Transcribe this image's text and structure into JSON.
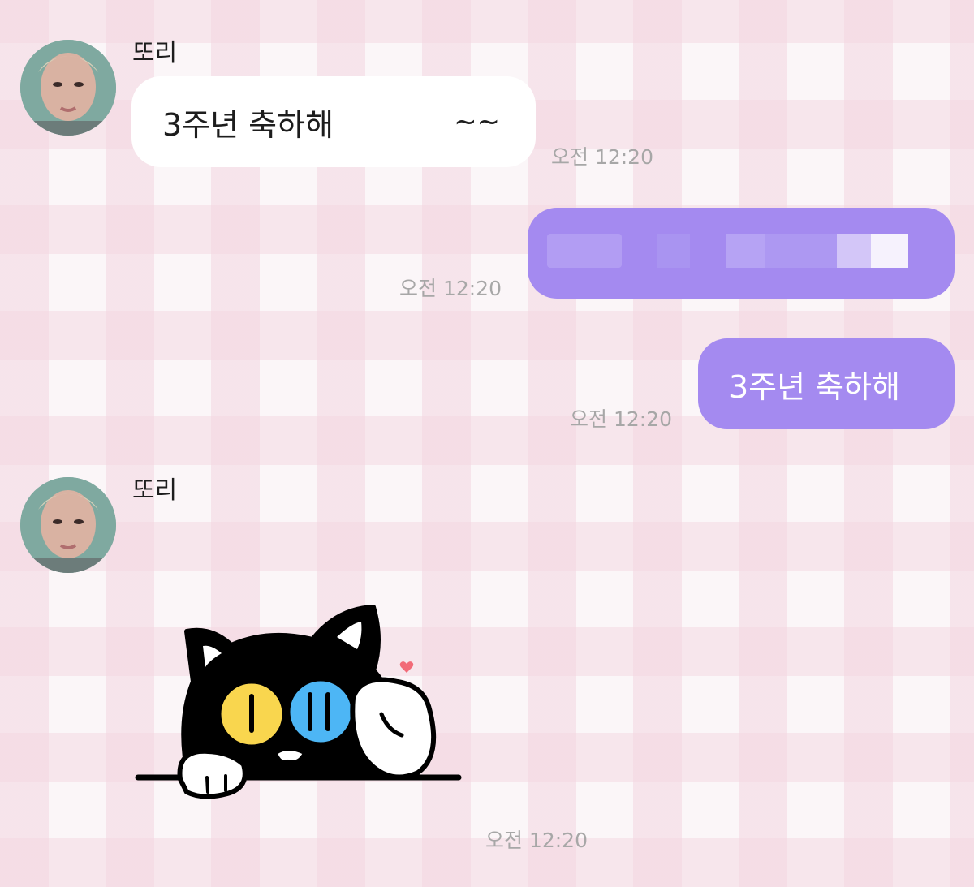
{
  "messages": [
    {
      "direction": "incoming",
      "sender": "또리",
      "text": "3주년 축하해",
      "suffix": "~~",
      "time": "오전 12:20"
    },
    {
      "direction": "outgoing",
      "text": "",
      "blurred": true,
      "time": "오전 12:20"
    },
    {
      "direction": "outgoing",
      "text": "3주년 축하해",
      "time": "오전 12:20"
    },
    {
      "direction": "incoming",
      "sender": "또리",
      "sticker": "black-cat-peeking-sticker",
      "time": "오전 12:20"
    }
  ],
  "colors": {
    "outgoing_bubble": "#a48af0",
    "incoming_bubble": "#ffffff",
    "timestamp": "#a7a7a7",
    "background_check": "#f3d6e0"
  },
  "icons": [
    "profile-avatar",
    "black-cat-sticker",
    "heart-icon"
  ]
}
